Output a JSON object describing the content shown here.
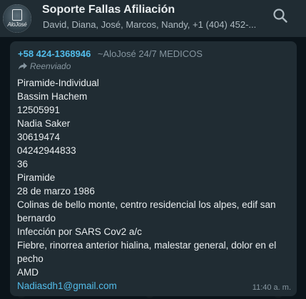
{
  "header": {
    "avatar_text": "AloJosé",
    "title": "Soporte Fallas Afiliación",
    "subtitle": "David, Diana, José, Marcos, Nandy, +1 (404) 452-..."
  },
  "message": {
    "sender_phone": "+58 424-1368946",
    "sender_name": "~AloJosé 24/7 MEDICOS",
    "forwarded_label": "Reenviado",
    "lines": [
      "Piramide-Individual",
      "Bassim Hachem",
      "12505991",
      "Nadia Saker",
      "30619474",
      "04242944833",
      "36",
      "Piramide",
      "28 de marzo 1986",
      "Colinas de bello monte, centro residencial los alpes, edif san bernardo",
      "Infección por SARS Cov2 a/c",
      "Fiebre, rinorrea anterior hialina, malestar general, dolor en el pecho",
      "AMD"
    ],
    "email": "Nadiasdh1@gmail.com",
    "time": "11:40 a. m."
  },
  "icons": {
    "search": "search-icon",
    "forward": "forward-icon"
  },
  "colors": {
    "header_bg": "#202c33",
    "chat_bg": "#0b141a",
    "bubble_bg": "#202c33",
    "link": "#53bdeb",
    "text": "#e9edef",
    "muted": "#8696a0"
  }
}
